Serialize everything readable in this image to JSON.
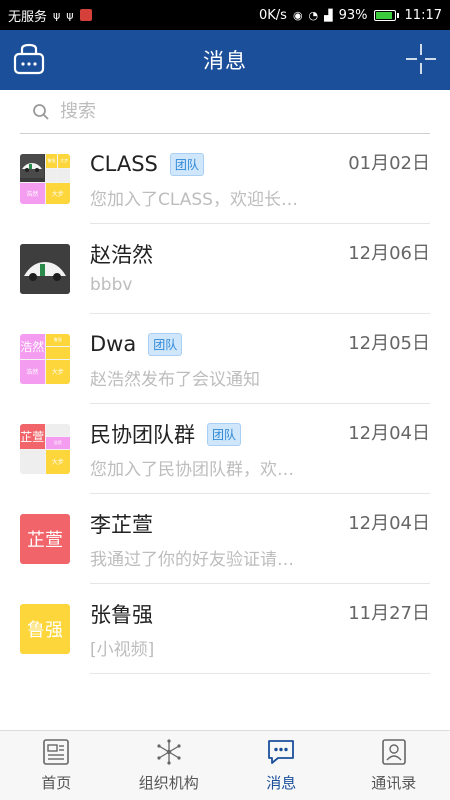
{
  "status_bar": {
    "carrier": "无服务",
    "speed": "0K/s",
    "battery": "93%",
    "time": "11:17",
    "battery_fill": 0.93
  },
  "header": {
    "title": "消息"
  },
  "search": {
    "placeholder": "搜索"
  },
  "conversations": [
    {
      "name": "CLASS",
      "tag": "团队",
      "date": "01月02日",
      "preview": "您加入了CLASS，欢迎长…"
    },
    {
      "name": "赵浩然",
      "tag": "",
      "date": "12月06日",
      "preview": "bbbv"
    },
    {
      "name": "Dwa",
      "tag": "团队",
      "date": "12月05日",
      "preview": "赵浩然发布了会议通知"
    },
    {
      "name": "民协团队群",
      "tag": "团队",
      "date": "12月04日",
      "preview": "您加入了民协团队群，欢…"
    },
    {
      "name": "李芷萱",
      "tag": "",
      "date": "12月04日",
      "preview": "我通过了你的好友验证请…"
    },
    {
      "name": "张鲁强",
      "tag": "",
      "date": "11月27日",
      "preview": "[小视频]"
    }
  ],
  "avatars": {
    "dwa_main": "浩然",
    "minxie_main": "芷萱",
    "li": "芷萱",
    "zhang": "鲁强",
    "mini_1": "鲁强",
    "mini_2": "浩然",
    "mini_3": "芷萱",
    "mini_4": "大步"
  },
  "colors": {
    "primary": "#1c4f9a",
    "tag_text": "#2f88d6",
    "avatar_pink": "#f49cf0",
    "avatar_red": "#f0646a",
    "avatar_yellow": "#fcd63a"
  },
  "tabs": [
    {
      "label": "首页",
      "icon": "home-icon",
      "active": false
    },
    {
      "label": "组织机构",
      "icon": "organization-icon",
      "active": false
    },
    {
      "label": "消息",
      "icon": "message-icon",
      "active": true
    },
    {
      "label": "通讯录",
      "icon": "contacts-icon",
      "active": false
    }
  ]
}
